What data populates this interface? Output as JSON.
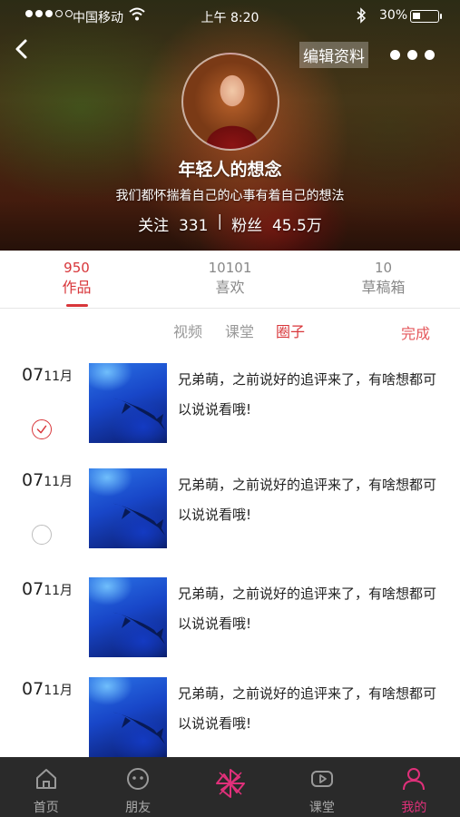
{
  "status_bar": {
    "carrier": "中国移动",
    "time": "上午 8:20",
    "battery": "30%"
  },
  "header": {
    "edit_label": "编辑资料",
    "name": "年轻人的想念",
    "bio": "我们都怀揣着自己的心事有着自己的想法",
    "following_label": "关注",
    "following_count": "331",
    "separator": "|",
    "followers_label": "粉丝",
    "followers_count": "45.5万"
  },
  "tabs": [
    {
      "count": "950",
      "label": "作品",
      "active": true
    },
    {
      "count": "10101",
      "label": "喜欢",
      "active": false
    },
    {
      "count": "10",
      "label": "草稿箱",
      "active": false
    }
  ],
  "subtabs": [
    {
      "label": "视频",
      "active": false
    },
    {
      "label": "课堂",
      "active": false
    },
    {
      "label": "圈子",
      "active": true
    }
  ],
  "done_label": "完成",
  "items": [
    {
      "day": "07",
      "month": "11月",
      "text": "兄弟萌，之前说好的追评来了，有啥想都可以说说看哦!",
      "checked": true
    },
    {
      "day": "07",
      "month": "11月",
      "text": "兄弟萌，之前说好的追评来了，有啥想都可以说说看哦!",
      "checked": false
    },
    {
      "day": "07",
      "month": "11月",
      "text": "兄弟萌，之前说好的追评来了，有啥想都可以说说看哦!",
      "checked": null
    },
    {
      "day": "07",
      "month": "11月",
      "text": "兄弟萌，之前说好的追评来了，有啥想都可以说说看哦!",
      "checked": null
    }
  ],
  "bottom_nav": [
    {
      "label": "首页",
      "icon": "home-icon",
      "active": false
    },
    {
      "label": "朋友",
      "icon": "friends-icon",
      "active": false
    },
    {
      "label": "",
      "icon": "pinwheel-icon",
      "active": false
    },
    {
      "label": "课堂",
      "icon": "play-icon",
      "active": false
    },
    {
      "label": "我的",
      "icon": "profile-icon",
      "active": true
    }
  ],
  "colors": {
    "accent": "#d8363a",
    "nav_active": "#e0307a",
    "nav_bg": "#2a2a2a"
  }
}
